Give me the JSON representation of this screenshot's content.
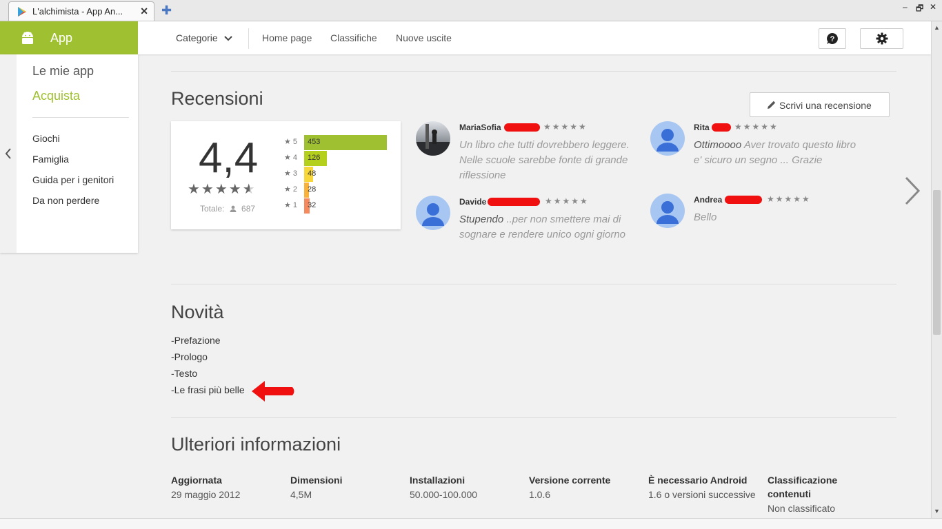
{
  "browser": {
    "tab_title": "L'alchimista - App An...",
    "close_glyph": "✕",
    "newtab_glyph": "✚",
    "minimize_glyph": "–",
    "restore_glyph": "🗗",
    "winclose_glyph": "✕"
  },
  "header": {
    "app_label": "App",
    "categories_label": "Categorie",
    "nav": [
      "Home page",
      "Classifiche",
      "Nuove uscite"
    ]
  },
  "sidebar": {
    "my_apps": "Le mie app",
    "shop": "Acquista",
    "items": [
      "Giochi",
      "Famiglia",
      "Guida per i genitori",
      "Da non perdere"
    ],
    "accent_color": "#9fc131"
  },
  "reviews": {
    "title": "Recensioni",
    "write_label": "Scrivi una recensione",
    "score": "4,4",
    "stars_glyph": "★★★★★",
    "total_label": "Totale:",
    "total_count": "687",
    "histogram": [
      {
        "star": "5",
        "count": 453,
        "label": "453",
        "color": "#9fc131"
      },
      {
        "star": "4",
        "count": 126,
        "label": "126",
        "color": "#b5cf1d"
      },
      {
        "star": "3",
        "count": 48,
        "label": "48",
        "color": "#f8d73a"
      },
      {
        "star": "2",
        "count": 28,
        "label": "28",
        "color": "#f9b33b"
      },
      {
        "star": "1",
        "count": 32,
        "label": "32",
        "color": "#f58a5f"
      }
    ],
    "items": [
      {
        "name": "MariaSofia",
        "rating": 5,
        "title": "",
        "text": "Un libro che tutti dovrebbero leggere. Nelle scuole sarebbe fonte di grande riflessione"
      },
      {
        "name": "Rita",
        "rating": 5,
        "title": "Ottimoooo",
        "text": " Aver trovato questo libro e' sicuro un segno ... Grazie"
      },
      {
        "name": "Davide",
        "rating": 5,
        "title": "Stupendo",
        "text": " ..per non smettere mai di sognare e rendere unico ogni giorno"
      },
      {
        "name": "Andrea",
        "rating": 5,
        "title": "",
        "text": "Bello"
      }
    ]
  },
  "novita": {
    "title": "Novità",
    "items": [
      "-Prefazione",
      "-Prologo",
      "-Testo",
      "-Le frasi più belle"
    ]
  },
  "info": {
    "title": "Ulteriori informazioni",
    "cols": [
      {
        "label": "Aggiornata",
        "value": "29 maggio 2012"
      },
      {
        "label": "Dimensioni",
        "value": "4,5M"
      },
      {
        "label": "Installazioni",
        "value": "50.000-100.000"
      },
      {
        "label": "Versione corrente",
        "value": "1.0.6"
      },
      {
        "label": "È necessario Android",
        "value": "1.6 o versioni successive"
      },
      {
        "label": "Classificazione contenuti",
        "value": "Non classificato"
      }
    ]
  }
}
